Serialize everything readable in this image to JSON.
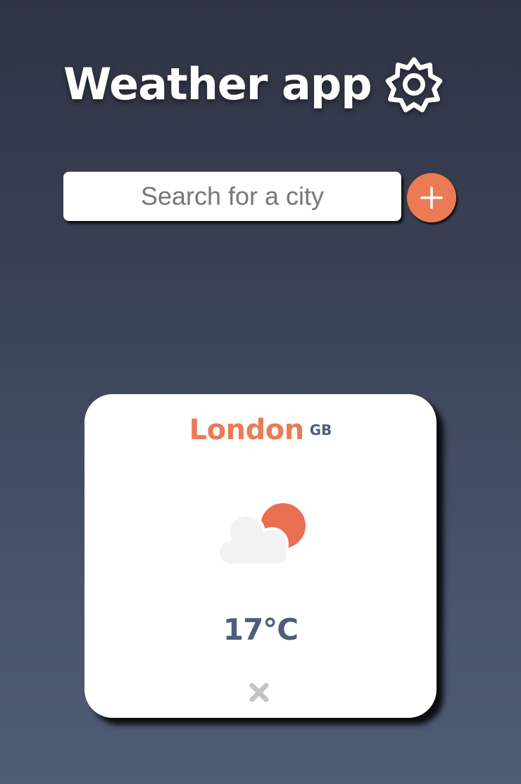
{
  "header": {
    "title": "Weather app",
    "settings_icon": "gear-icon"
  },
  "search": {
    "placeholder": "Search for a city",
    "value": "",
    "add_button_icon": "plus-icon"
  },
  "cities": [
    {
      "name": "London",
      "country": "GB",
      "temperature": "17°C",
      "condition_icon": "partly-cloudy-icon",
      "remove_icon": "close-icon"
    }
  ],
  "colors": {
    "accent": "#ea7b55",
    "text_secondary": "#4f5d7a",
    "background_top": "#2f3444",
    "background_bottom": "#4e5b75"
  }
}
